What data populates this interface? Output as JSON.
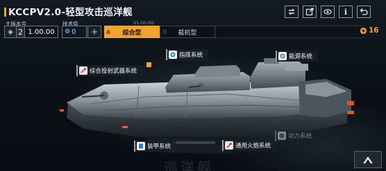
{
  "header": {
    "title": "KCCPV2.0-轻型攻击巡洋舰",
    "icons": [
      "swap-arrows-icon",
      "share-icon",
      "view-eye-icon",
      "info-icon",
      "return-icon"
    ],
    "info_label": "i"
  },
  "identity": {
    "label": "主版本号",
    "number": "2",
    "version": "1.00.00"
  },
  "tech": {
    "label": "技术值",
    "value": "0",
    "add_label": "+"
  },
  "tabs": {
    "version_label": "V1.00-00-",
    "items": [
      {
        "key": "A",
        "label": "综合型",
        "active": true
      },
      {
        "key": "O",
        "label": "载机型",
        "active": false
      }
    ]
  },
  "resource": {
    "value": "16",
    "color": "#f0a531"
  },
  "systems": [
    {
      "id": "command",
      "label": "指挥系统",
      "icon": "command-system-icon"
    },
    {
      "id": "energy",
      "label": "能源系统",
      "icon": "energy-system-icon"
    },
    {
      "id": "projectile",
      "label": "综合投射武器系统",
      "icon": "projectile-weapon-icon"
    },
    {
      "id": "armor",
      "label": "装甲系统",
      "icon": "armor-system-icon"
    },
    {
      "id": "artillery",
      "label": "通用火炮系统",
      "icon": "artillery-system-icon"
    },
    {
      "id": "power",
      "label": "动力系统",
      "icon": "power-system-icon"
    }
  ],
  "watermark": "巡洋舰",
  "colors": {
    "accent": "#f0a531",
    "panel": "#0e1218",
    "text": "#e8edf2",
    "tech": "#8fd2ff"
  }
}
